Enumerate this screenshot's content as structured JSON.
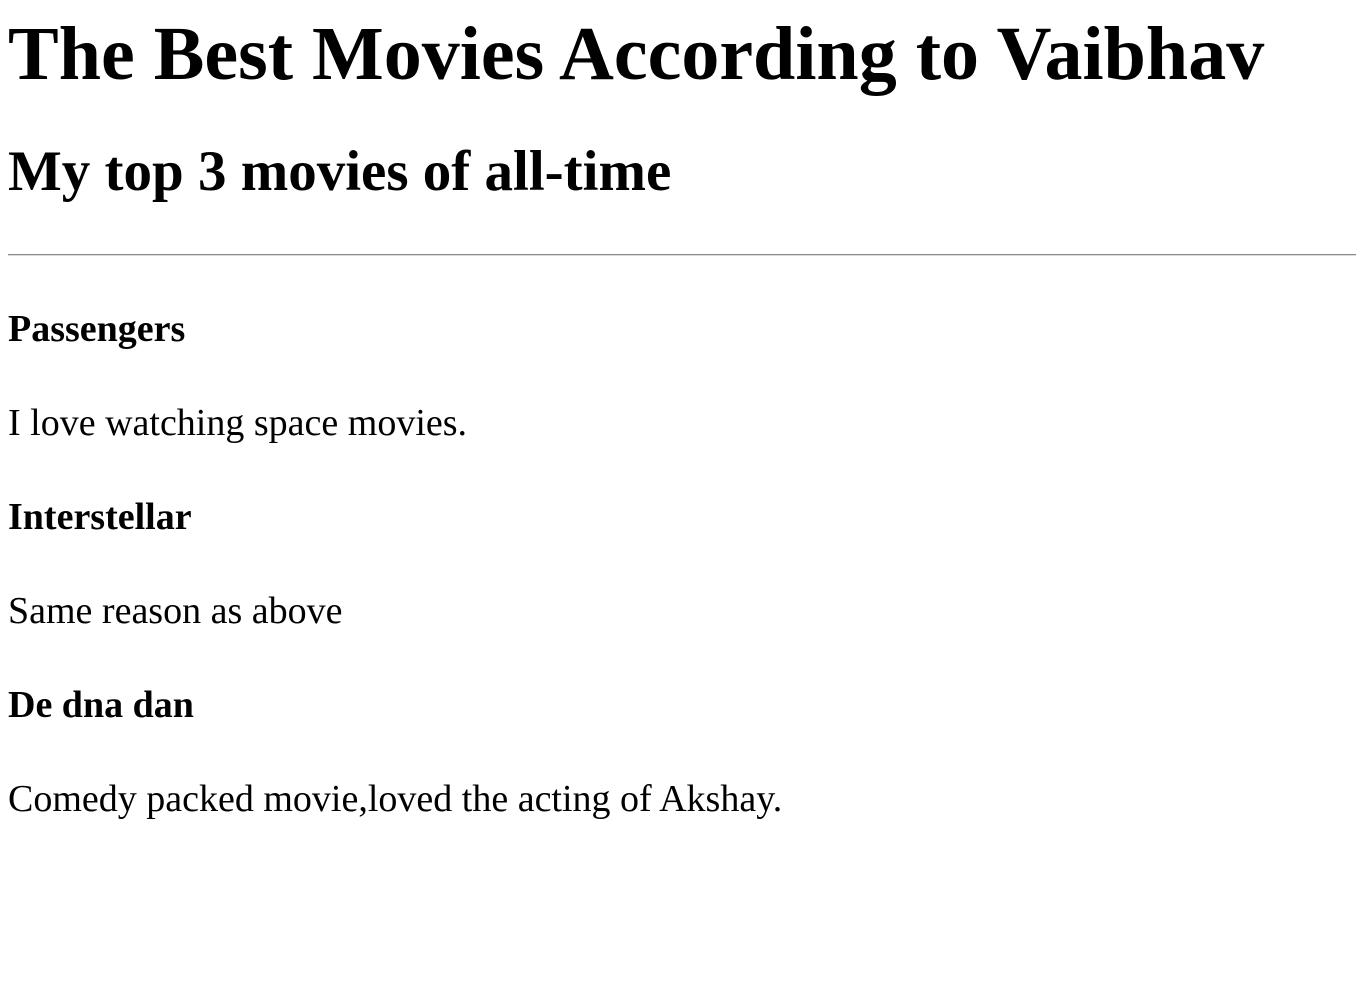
{
  "page": {
    "title": "The Best Movies According to Vaibhav",
    "subtitle": "My top 3 movies of all-time"
  },
  "movies": [
    {
      "name": "Passengers",
      "comment": "I love watching space movies."
    },
    {
      "name": "Interstellar",
      "comment": "Same reason as above"
    },
    {
      "name": "De dna dan",
      "comment": "Comedy packed movie,loved the acting of Akshay."
    }
  ]
}
